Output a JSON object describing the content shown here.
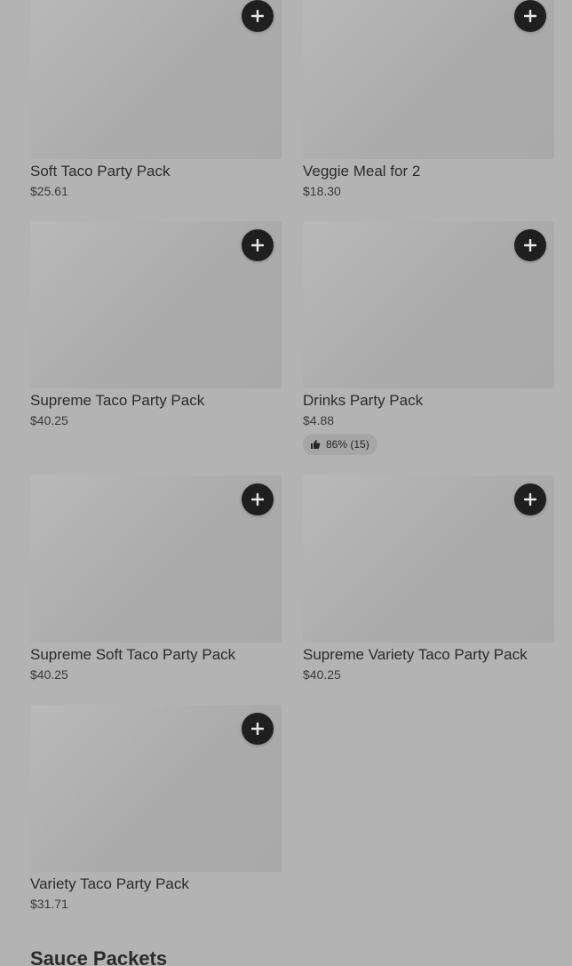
{
  "products": [
    {
      "name": "Soft Taco Party Pack",
      "price": "$25.61"
    },
    {
      "name": "Veggie Meal for 2",
      "price": "$18.30"
    },
    {
      "name": "Supreme Taco Party Pack",
      "price": "$40.25"
    },
    {
      "name": "Drinks Party Pack",
      "price": "$4.88",
      "rating": "86% (15)"
    },
    {
      "name": "Supreme Soft Taco Party Pack",
      "price": "$40.25"
    },
    {
      "name": "Supreme Variety Taco Party Pack",
      "price": "$40.25"
    },
    {
      "name": "Variety Taco Party Pack",
      "price": "$31.71"
    }
  ],
  "next_section": {
    "title": "Sauce Packets"
  },
  "icons": {
    "add": "plus-icon",
    "rating": "thumbs-up-icon"
  },
  "colors": {
    "background": "#b3b3b3",
    "add_button": "#1f1f1f"
  }
}
